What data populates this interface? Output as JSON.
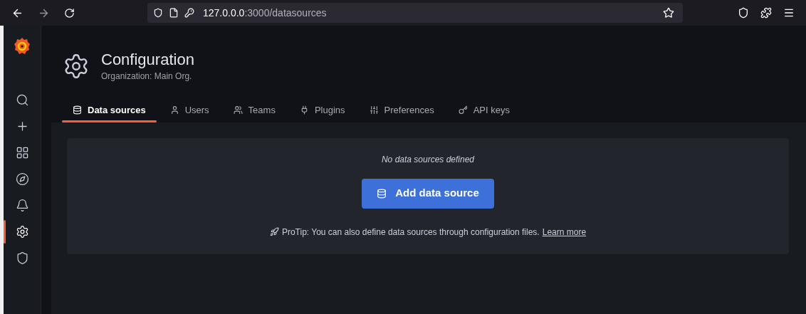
{
  "browser": {
    "url_host": "127.0.0.0",
    "url_path": ":3000/datasources"
  },
  "sidebar": {
    "items": [
      {
        "kind": "search",
        "selected": false
      },
      {
        "kind": "create",
        "selected": false
      },
      {
        "kind": "dashboards",
        "selected": false
      },
      {
        "kind": "explore",
        "selected": false
      },
      {
        "kind": "alerting",
        "selected": false
      },
      {
        "kind": "configuration",
        "selected": true
      },
      {
        "kind": "admin",
        "selected": false
      }
    ]
  },
  "header": {
    "title": "Configuration",
    "subtitle": "Organization: Main Org."
  },
  "tabs": [
    {
      "kind": "datasources",
      "label": "Data sources",
      "selected": true
    },
    {
      "kind": "users",
      "label": "Users",
      "selected": false
    },
    {
      "kind": "teams",
      "label": "Teams",
      "selected": false
    },
    {
      "kind": "plugins",
      "label": "Plugins",
      "selected": false
    },
    {
      "kind": "preferences",
      "label": "Preferences",
      "selected": false
    },
    {
      "kind": "apikeys",
      "label": "API keys",
      "selected": false
    }
  ],
  "empty_state": {
    "message": "No data sources defined",
    "button": "Add data source",
    "protip": "ProTip: You can also define data sources through configuration files.",
    "link": "Learn more"
  }
}
